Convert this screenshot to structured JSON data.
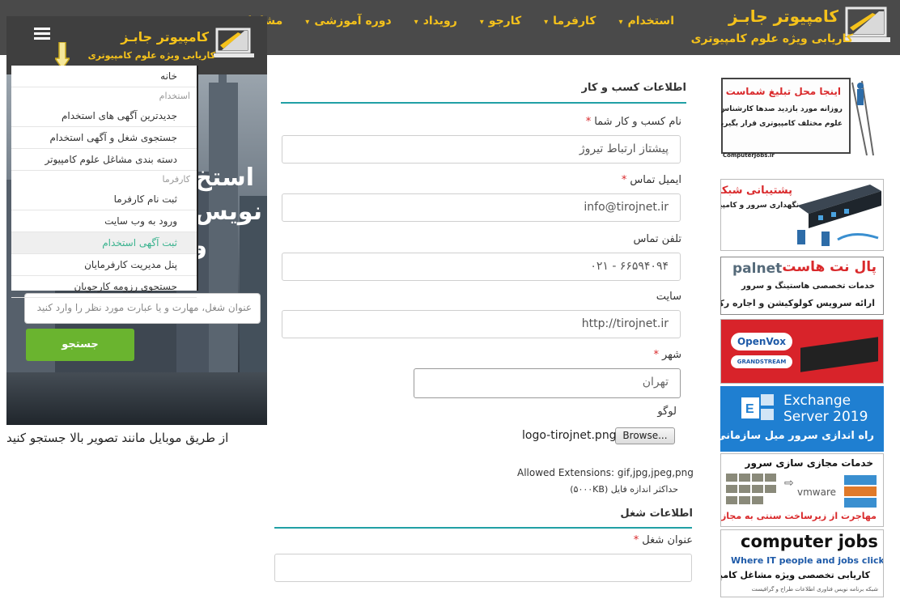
{
  "header": {
    "site_title": "کامپیوتر جابـز",
    "site_subtitle": "کاریابی ویژه علوم کامپیوتری",
    "nav": [
      "استخدام",
      "کارفرما",
      "کارجو",
      "رویداد",
      "دوره آموزشی",
      "مشاغل"
    ]
  },
  "mobile": {
    "site_title": "کامپیوتر جابـز",
    "site_subtitle": "کاریابی ویژه علوم کامپیوتری",
    "menu": {
      "home": "خانه",
      "section_employment": "استخدام",
      "employment_items": [
        "جدیدترین آگهی های استخدام",
        "جستجوی شغل و آگهی استخدام",
        "دسته بندی مشاغل علوم کامپیوتر"
      ],
      "section_employer": "کارفرما",
      "employer_items": [
        "ثبت نام کارفرما",
        "ورود به وب سایت",
        "ثبت آگهی استخدام",
        "پنل مدیریت کارفرمایان",
        "جستجوی رزومه کارجویان"
      ]
    },
    "hero_line1": "استخ",
    "hero_line2": "نویس",
    "hero_line3": "و",
    "search_placeholder": "عنوان شغل، مهارت و یا عبارت مورد نظر را وارد کنید",
    "search_button": "جستجو",
    "note": "از طریق موبایل مانند تصویر بالا جستجو کنید"
  },
  "form": {
    "business_section": "اطلاعات کسب و کار",
    "business_name_label": "نام کسب و کار شما",
    "business_name_value": "پیشتاز ارتباط تیروژ",
    "email_label": "ایمیل تماس",
    "email_value": "info@tirojnet.ir",
    "phone_label": "تلفن تماس",
    "phone_value": "۰۲۱ - ۶۶۵۹۴۰۹۴",
    "site_label": "سایت",
    "site_value": "http://tirojnet.ir",
    "city_label": "شهر",
    "city_value": "تهران",
    "logo_label": "لوگو",
    "browse_label": "Browse...",
    "logo_file": "logo-tirojnet.png",
    "allowed_ext": "Allowed Extensions: gif,jpg,jpeg,png",
    "max_size": "حداکثر اندازه فایل (۵۰۰۰KB)",
    "job_section": "اطلاعات شغل",
    "job_title_label": "عنوان شغل",
    "required_mark": "*"
  },
  "ads": {
    "ad1_title": "اینجا محل تبلیغ شماست",
    "ad1_text1": "روزانه مورد بازدید صدها کارشناس و مدیر",
    "ad1_text2": "علوم مختلف کامپیوتری قرار بگیرید",
    "ad1_footer": "ComputerJobs.ir",
    "ad2_title": "پشتیبانی شبکه",
    "ad2_text": "نگهداری سرور و کامپیوتر",
    "ad3_brand": "palnet",
    "ad3_title": "پال نت هاست",
    "ad3_line1": "خدمات تخصصی هاستینگ و سرور",
    "ad3_line2": "ارائه سرویس کولوکیشن و اجاره رک",
    "ad4_brand1": "OpenVox",
    "ad4_brand2": "GRANDSTREAM",
    "ad5_line1": "Exchange",
    "ad5_line2": "Server 2019",
    "ad5_text": "راه اندازی سرور میل سازمانی",
    "ad6_title": "خدمات مجازی سازی سرور",
    "ad6_brand": "vmware",
    "ad6_text": "مهاجرت از زیرساخت سنتی به مجازی",
    "ad7_brand": "computer jobs",
    "ad7_tagline": "Where IT people and jobs click",
    "ad7_text": "کاریابی تخصصی ویژه مشاغل کامپیوتری",
    "ad7_footer": "شبکه  برنامه نویس  فناوری اطلاعات طراح و گرافیست",
    "colors": {
      "accent": "#f5c21b",
      "teal": "#21a0a5",
      "green": "#6ab42f",
      "red": "#d9292b"
    }
  }
}
